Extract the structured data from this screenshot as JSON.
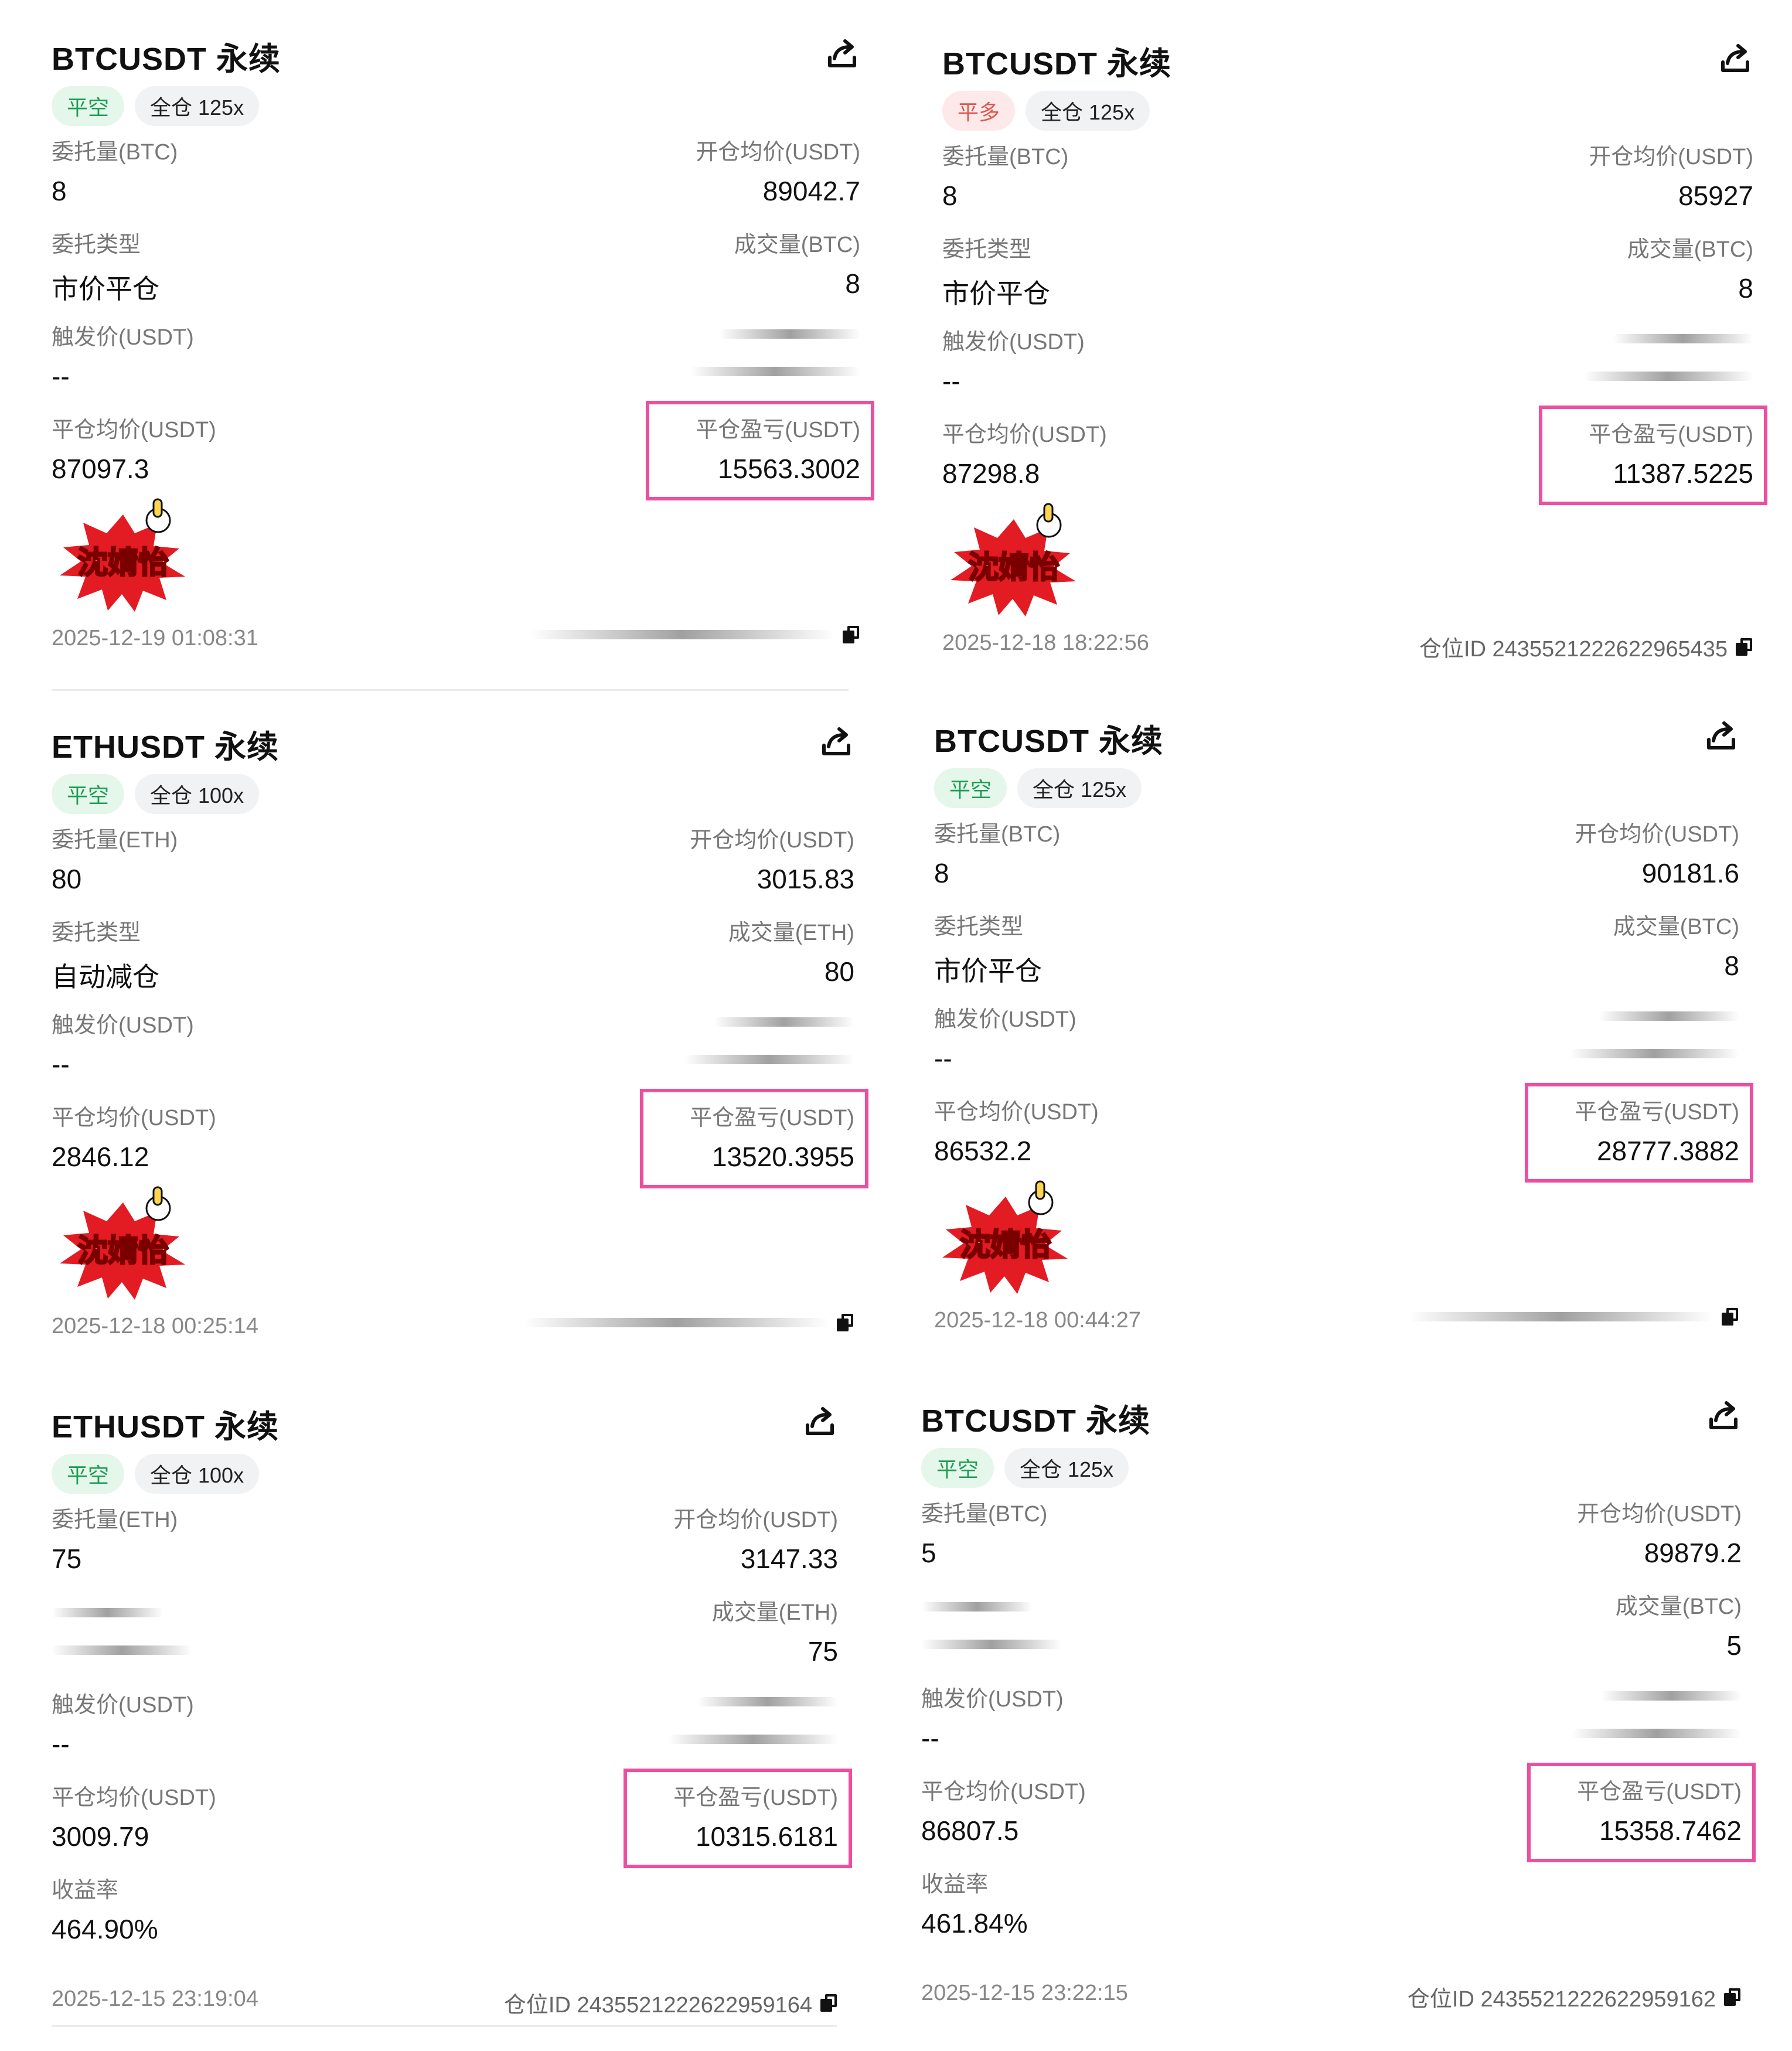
{
  "colors": {
    "highlight": "#ec4fa1",
    "short_tag": "#1f9d55",
    "long_tag": "#e0564f",
    "sticker_red": "#e31b23"
  },
  "cards": [
    {
      "title": "BTCUSDT 永续",
      "side": "平空",
      "side_color": "green",
      "margin": "全仓 125x",
      "qty_label": "委托量(BTC)",
      "qty": "8",
      "open_label": "开仓均价(USDT)",
      "open": "89042.7",
      "type_label": "委托类型",
      "type": "市价平仓",
      "filled_label": "成交量(BTC)",
      "filled": "8",
      "trigger_label": "触发价(USDT)",
      "trigger": "--",
      "close_label": "平仓均价(USDT)",
      "close": "87097.3",
      "pnl_label": "平仓盈亏(USDT)",
      "pnl": "15563.3002",
      "time": "2025-12-19 01:08:31",
      "posid": "",
      "sticker": "沈婧怡",
      "share_icon": "share-icon"
    },
    {
      "title": "BTCUSDT 永续",
      "side": "平多",
      "side_color": "red",
      "margin": "全仓 125x",
      "qty_label": "委托量(BTC)",
      "qty": "8",
      "open_label": "开仓均价(USDT)",
      "open": "85927",
      "type_label": "委托类型",
      "type": "市价平仓",
      "filled_label": "成交量(BTC)",
      "filled": "8",
      "trigger_label": "触发价(USDT)",
      "trigger": "--",
      "close_label": "平仓均价(USDT)",
      "close": "87298.8",
      "pnl_label": "平仓盈亏(USDT)",
      "pnl": "11387.5225",
      "time": "2025-12-18 18:22:56",
      "posid": "仓位ID 2435521222622965435",
      "sticker": "沈婧怡",
      "share_icon": "share-icon"
    },
    {
      "title": "ETHUSDT 永续",
      "side": "平空",
      "side_color": "green",
      "margin": "全仓 100x",
      "qty_label": "委托量(ETH)",
      "qty": "80",
      "open_label": "开仓均价(USDT)",
      "open": "3015.83",
      "type_label": "委托类型",
      "type": "自动减仓",
      "filled_label": "成交量(ETH)",
      "filled": "80",
      "trigger_label": "触发价(USDT)",
      "trigger": "--",
      "close_label": "平仓均价(USDT)",
      "close": "2846.12",
      "pnl_label": "平仓盈亏(USDT)",
      "pnl": "13520.3955",
      "time": "2025-12-18 00:25:14",
      "posid": "",
      "sticker": "沈婧怡",
      "share_icon": "share-icon"
    },
    {
      "title": "BTCUSDT 永续",
      "side": "平空",
      "side_color": "green",
      "margin": "全仓 125x",
      "qty_label": "委托量(BTC)",
      "qty": "8",
      "open_label": "开仓均价(USDT)",
      "open": "90181.6",
      "type_label": "委托类型",
      "type": "市价平仓",
      "filled_label": "成交量(BTC)",
      "filled": "8",
      "trigger_label": "触发价(USDT)",
      "trigger": "--",
      "close_label": "平仓均价(USDT)",
      "close": "86532.2",
      "pnl_label": "平仓盈亏(USDT)",
      "pnl": "28777.3882",
      "time": "2025-12-18 00:44:27",
      "posid": "",
      "sticker": "沈婧怡",
      "share_icon": "share-icon"
    },
    {
      "title": "ETHUSDT 永续",
      "side": "平空",
      "side_color": "green",
      "margin": "全仓 100x",
      "qty_label": "委托量(ETH)",
      "qty": "75",
      "open_label": "开仓均价(USDT)",
      "open": "3147.33",
      "type_label": "",
      "type": "",
      "filled_label": "成交量(ETH)",
      "filled": "75",
      "trigger_label": "触发价(USDT)",
      "trigger": "--",
      "close_label": "平仓均价(USDT)",
      "close": "3009.79",
      "pnl_label": "平仓盈亏(USDT)",
      "pnl": "10315.6181",
      "roi_label": "收益率",
      "roi": "464.90%",
      "time": "2025-12-15 23:19:04",
      "posid": "仓位ID 2435521222622959164",
      "share_icon": "share-icon"
    },
    {
      "title": "BTCUSDT 永续",
      "side": "平空",
      "side_color": "green",
      "margin": "全仓 125x",
      "qty_label": "委托量(BTC)",
      "qty": "5",
      "open_label": "开仓均价(USDT)",
      "open": "89879.2",
      "type_label": "",
      "type": "",
      "filled_label": "成交量(BTC)",
      "filled": "5",
      "trigger_label": "触发价(USDT)",
      "trigger": "--",
      "close_label": "平仓均价(USDT)",
      "close": "86807.5",
      "pnl_label": "平仓盈亏(USDT)",
      "pnl": "15358.7462",
      "roi_label": "收益率",
      "roi": "461.84%",
      "time": "2025-12-15 23:22:15",
      "posid": "仓位ID 2435521222622959162",
      "share_icon": "share-icon"
    }
  ]
}
